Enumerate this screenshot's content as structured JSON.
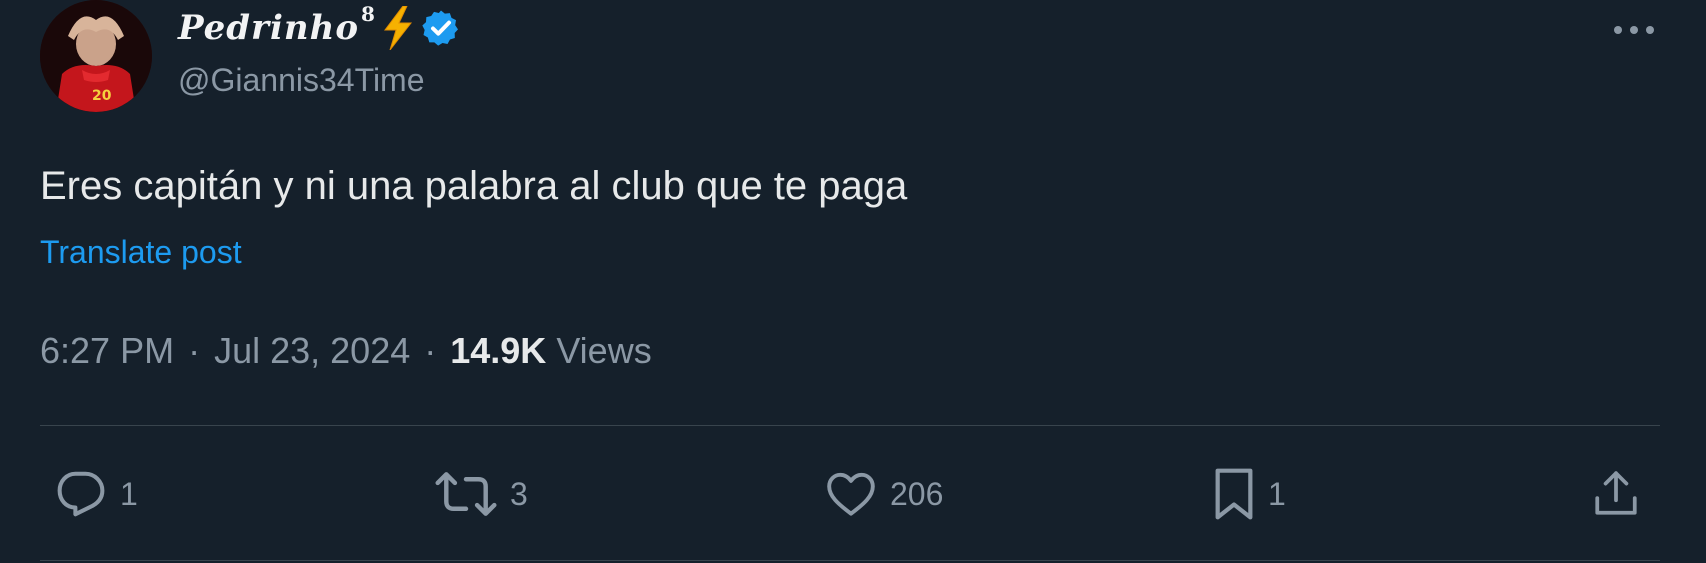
{
  "author": {
    "display_name": "Pedrinho",
    "display_name_sup": "8",
    "bolt_emoji": "⚡",
    "verified": true,
    "handle": "@Giannis34Time",
    "avatar_jersey_number": "20"
  },
  "post": {
    "text": "Eres capitán y ni una palabra al club que te paga",
    "translate_label": "Translate post"
  },
  "meta": {
    "time": "6:27 PM",
    "separator": "·",
    "date": "Jul 23, 2024",
    "views_count": "14.9K",
    "views_label": "Views"
  },
  "actions": {
    "reply_count": "1",
    "repost_count": "3",
    "like_count": "206",
    "bookmark_count": "1"
  },
  "icons": {
    "more": "more-horizontal-icon",
    "reply": "reply-icon",
    "repost": "repost-icon",
    "like": "heart-icon",
    "bookmark": "bookmark-icon",
    "share": "share-icon",
    "verified": "verified-badge-icon",
    "bolt": "lightning-bolt-icon"
  },
  "colors": {
    "background": "#15202b",
    "text_primary": "#e7e9ea",
    "text_secondary": "#8b98a5",
    "link": "#1d9bf0",
    "verified": "#1d9bf0",
    "divider": "#38444d"
  }
}
